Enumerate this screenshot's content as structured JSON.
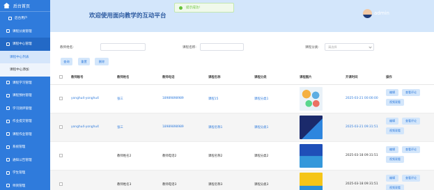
{
  "sidebar": {
    "title": "后台首页",
    "items": [
      {
        "label": "后台用户"
      },
      {
        "label": "课程分类管理"
      },
      {
        "label": "课程中心管理"
      },
      {
        "label": "课程中心列表"
      },
      {
        "label": "课程中心添加"
      },
      {
        "label": "课程学习管理"
      },
      {
        "label": "课程预约管理"
      },
      {
        "label": "学习测评管理"
      },
      {
        "label": "作业提交管理"
      },
      {
        "label": "课程作业管理"
      },
      {
        "label": "系统管理"
      },
      {
        "label": "通知公告管理"
      },
      {
        "label": "学生管理"
      },
      {
        "label": "师资管理"
      }
    ]
  },
  "header": {
    "title": "欢迎使用面向教学的互动平台",
    "user": "admin"
  },
  "toast": {
    "text": "提示成功!"
  },
  "search": {
    "teacher_label": "教师姓名:",
    "course_label": "课程名称:",
    "category_label": "课程分类:",
    "category_placeholder": "请选择",
    "query_btn": "查询",
    "reset_btn": "重置",
    "delete_btn": "删除"
  },
  "table": {
    "columns": [
      "教师账号",
      "教师姓名",
      "教师电话",
      "课程名称",
      "课程分类",
      "课程图片",
      "开课时间",
      "操作"
    ],
    "rows": [
      {
        "account": "yonghu4-yonghu4",
        "name": "张三",
        "phone": "18989898989",
        "course": "课程15",
        "category": "课程分类1",
        "time": "2025-03-21 00:00:00"
      },
      {
        "account": "yonghu4-yonghu4",
        "name": "张三",
        "phone": "18989898989",
        "course": "课程名称1",
        "category": "课程分类1",
        "time": "2025-03-21 09:31:51"
      },
      {
        "account": "",
        "name": "教师姓名2",
        "phone": "教师电话2",
        "course": "课程名称2",
        "category": "课程分类2",
        "time": "2025-03-18 09:31:51"
      },
      {
        "account": "",
        "name": "教师姓名3",
        "phone": "教师电话3",
        "course": "课程名称3",
        "category": "课程分类3",
        "time": "2025-03-18 09:31:51"
      }
    ],
    "actions": {
      "edit": "编辑",
      "view_review": "查看评论",
      "view_detail": "视频观看"
    }
  },
  "colors": {
    "primary": "#2f7bdc",
    "header_bg": "#d3e6fb"
  }
}
